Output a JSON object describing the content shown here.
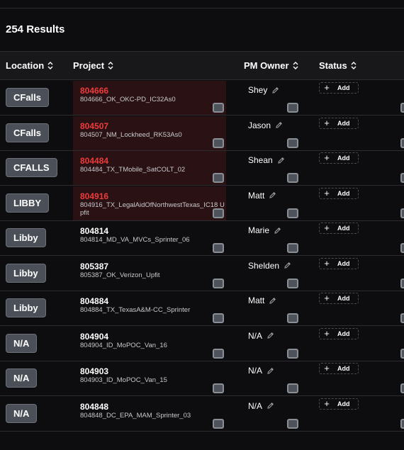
{
  "results_label": "254 Results",
  "columns": {
    "location": "Location",
    "project": "Project",
    "pm_owner": "PM Owner",
    "status": "Status"
  },
  "add_label": "Add",
  "rows": [
    {
      "location": "CFalls",
      "project_number": "804666",
      "project_name": "804666_OK_OKC-PD_IC32As0",
      "owner": "Shey",
      "flagged": true
    },
    {
      "location": "CFalls",
      "project_number": "804507",
      "project_name": "804507_NM_Lockheed_RK53As0",
      "owner": "Jason",
      "flagged": true
    },
    {
      "location": "CFALLS",
      "project_number": "804484",
      "project_name": "804484_TX_TMobile_SatCOLT_02",
      "owner": "Shean",
      "flagged": true
    },
    {
      "location": "LIBBY",
      "project_number": "804916",
      "project_name": "804916_TX_LegalAidOfNorthwestTexas_IC18 Upfit",
      "owner": "Matt",
      "flagged": true
    },
    {
      "location": "Libby",
      "project_number": "804814",
      "project_name": "804814_MD_VA_MVCs_Sprinter_06",
      "owner": "Marie",
      "flagged": false
    },
    {
      "location": "Libby",
      "project_number": "805387",
      "project_name": "805387_OK_Verizon_Upfit",
      "owner": "Shelden",
      "flagged": false
    },
    {
      "location": "Libby",
      "project_number": "804884",
      "project_name": "804884_TX_TexasA&M-CC_Sprinter",
      "owner": "Matt",
      "flagged": false
    },
    {
      "location": "N/A",
      "project_number": "804904",
      "project_name": "804904_ID_MoPOC_Van_16",
      "owner": "N/A",
      "flagged": false
    },
    {
      "location": "N/A",
      "project_number": "804903",
      "project_name": "804903_ID_MoPOC_Van_15",
      "owner": "N/A",
      "flagged": false
    },
    {
      "location": "N/A",
      "project_number": "804848",
      "project_name": "804848_DC_EPA_MAM_Sprinter_03",
      "owner": "N/A",
      "flagged": false
    }
  ],
  "icons": {
    "sort": "sort-updown-icon",
    "edit": "pencil-icon",
    "add": "plus-icon",
    "checkbox": "checkbox-icon"
  }
}
